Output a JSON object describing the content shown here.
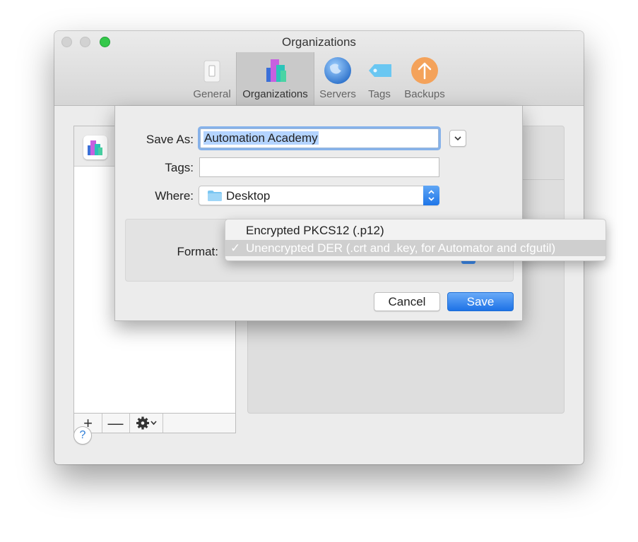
{
  "window": {
    "title": "Organizations"
  },
  "toolbar": {
    "items": [
      {
        "label": "General",
        "icon": "general-switch-icon",
        "selected": false
      },
      {
        "label": "Organizations",
        "icon": "organizations-icon",
        "selected": true
      },
      {
        "label": "Servers",
        "icon": "globe-icon",
        "selected": false
      },
      {
        "label": "Tags",
        "icon": "tag-icon",
        "selected": false
      },
      {
        "label": "Backups",
        "icon": "backup-arrow-icon",
        "selected": false
      }
    ]
  },
  "list_footer": {
    "add": "+",
    "remove": "—"
  },
  "help": {
    "label": "?"
  },
  "sheet": {
    "save_as_label": "Save As:",
    "save_as_value": "Automation Academy",
    "tags_label": "Tags:",
    "tags_value": "",
    "where_label": "Where:",
    "where_value": "Desktop",
    "format_label": "Format:",
    "cancel_label": "Cancel",
    "save_label": "Save"
  },
  "format_menu": {
    "options": [
      {
        "label": "Encrypted PKCS12 (.p12)",
        "checked": false
      },
      {
        "label": "Unencrypted DER (.crt and .key, for Automator and cfgutil)",
        "checked": true
      }
    ],
    "check_mark": "✓"
  },
  "colors": {
    "accent": "#1f76e8",
    "close_light": "#d2d2d2",
    "zoom_light": "#34c84a"
  }
}
